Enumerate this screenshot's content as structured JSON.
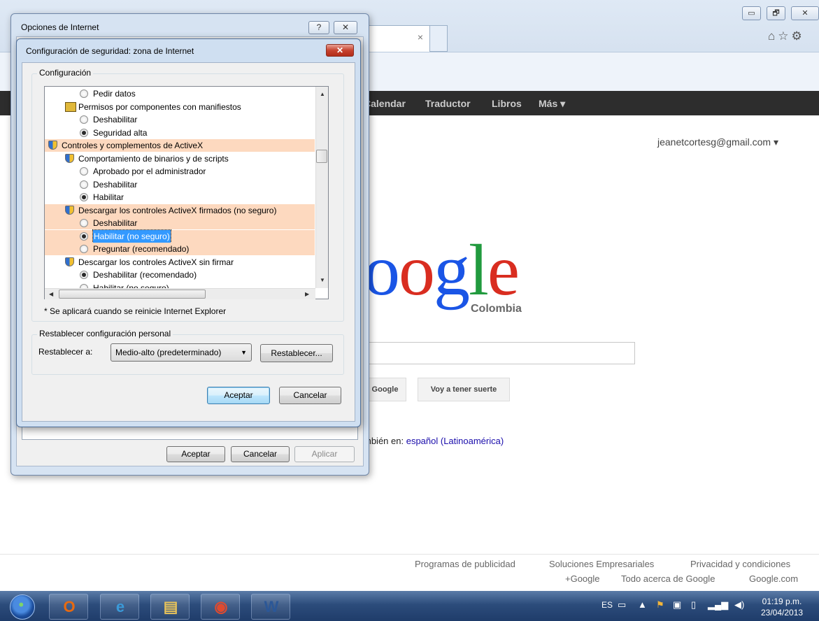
{
  "browser": {
    "tab_close": "×",
    "window_buttons": [
      "▭",
      "🗗",
      "✕"
    ],
    "toolbar_icons": "⌂☆⚙"
  },
  "google": {
    "nav": [
      "Calendar",
      "Traductor",
      "Libros",
      "Más ▾"
    ],
    "account": "jeanetcortesg@gmail.com ▾",
    "logo_text": "oogle",
    "logo_sub": "Colombia",
    "button_search": "Google",
    "button_lucky": "Voy a tener suerte",
    "lang_prefix": "mbién en:",
    "lang_link": "español (Latinoamérica)",
    "footer_row1": [
      "Programas de publicidad",
      "Soluciones Empresariales",
      "Privacidad y condiciones"
    ],
    "footer_row2": [
      "+Google",
      "Todo acerca de Google",
      "Google.com"
    ],
    "colors": {
      "g_blue": "#1a55e6",
      "g_red": "#d92d20",
      "g_yellow": "#f4b400",
      "g_green": "#219a3e",
      "nav_bg": "#2d2d2d"
    }
  },
  "internet_options": {
    "title": "Opciones de Internet",
    "help_button": "?",
    "close_button": "✕",
    "ok_label": "Aceptar",
    "cancel_label": "Cancelar",
    "apply_label": "Aplicar"
  },
  "security_dialog": {
    "title": "Configuración de seguridad: zona de Internet",
    "close_button": "✕",
    "group_label": "Configuración",
    "rows": [
      {
        "type": "radio",
        "checked": false,
        "label": "Pedir datos",
        "indent": 2,
        "highlight": false
      },
      {
        "type": "cert",
        "label": "Permisos por componentes con manifiestos",
        "indent": 1,
        "highlight": false
      },
      {
        "type": "radio",
        "checked": false,
        "label": "Deshabilitar",
        "indent": 2,
        "highlight": false
      },
      {
        "type": "radio",
        "checked": true,
        "label": "Seguridad alta",
        "indent": 2,
        "highlight": false
      },
      {
        "type": "shield",
        "label": "Controles y complementos de ActiveX",
        "indent": 0,
        "highlight": true
      },
      {
        "type": "shield",
        "label": "Comportamiento de binarios y de scripts",
        "indent": 1,
        "highlight": false
      },
      {
        "type": "radio",
        "checked": false,
        "label": "Aprobado por el administrador",
        "indent": 2,
        "highlight": false
      },
      {
        "type": "radio",
        "checked": false,
        "label": "Deshabilitar",
        "indent": 2,
        "highlight": false
      },
      {
        "type": "radio",
        "checked": true,
        "label": "Habilitar",
        "indent": 2,
        "highlight": false
      },
      {
        "type": "shield",
        "label": "Descargar los controles ActiveX firmados (no seguro)",
        "indent": 1,
        "highlight": true
      },
      {
        "type": "radio",
        "checked": false,
        "label": "Deshabilitar",
        "indent": 2,
        "highlight": true
      },
      {
        "type": "radio",
        "checked": true,
        "label": "Habilitar (no seguro)",
        "indent": 2,
        "highlight": true,
        "selected": true
      },
      {
        "type": "radio",
        "checked": false,
        "label": "Preguntar (recomendado)",
        "indent": 2,
        "highlight": true
      },
      {
        "type": "shield",
        "label": "Descargar los controles ActiveX sin firmar",
        "indent": 1,
        "highlight": false
      },
      {
        "type": "radio",
        "checked": true,
        "label": "Deshabilitar (recomendado)",
        "indent": 2,
        "highlight": false
      },
      {
        "type": "radio",
        "checked": false,
        "label": "Habilitar (no seguro)",
        "indent": 2,
        "highlight": false
      }
    ],
    "note": "* Se aplicará cuando se reinicie Internet Explorer",
    "reset_group_label": "Restablecer configuración personal",
    "reset_to_label": "Restablecer a:",
    "reset_select_value": "Medio-alto (predeterminado)",
    "reset_button": "Restablecer...",
    "ok_label": "Aceptar",
    "cancel_label": "Cancelar",
    "highlight_color": "#fdd9bf"
  },
  "taskbar": {
    "language": "ES",
    "time": "01:19 p.m.",
    "date": "23/04/2013",
    "apps": [
      {
        "icon": "outlook-icon",
        "glyph": "O",
        "color": "#e86a10"
      },
      {
        "icon": "internet-explorer-icon",
        "glyph": "e",
        "color": "#3a9ad9"
      },
      {
        "icon": "file-explorer-icon",
        "glyph": "▤",
        "color": "#e8c35a"
      },
      {
        "icon": "chrome-icon",
        "glyph": "◉",
        "color": "#e04a2f"
      },
      {
        "icon": "word-icon",
        "glyph": "W",
        "color": "#2b5797"
      }
    ]
  }
}
